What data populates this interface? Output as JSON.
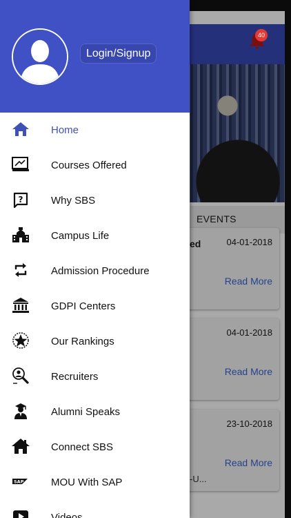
{
  "background": {
    "notification_count": "40",
    "tab_label": "EVENTS",
    "cards": [
      {
        "partial_title": "ed",
        "date": "04-01-2018",
        "read_more": "Read More",
        "snippet": ""
      },
      {
        "partial_title": "",
        "date": "04-01-2018",
        "read_more": "Read More",
        "snippet": ""
      },
      {
        "partial_title": "",
        "date": "23-10-2018",
        "read_more": "Read More",
        "snippet": "-U..."
      }
    ]
  },
  "drawer": {
    "header_color": "#3f51c4",
    "login_label": "Login/Signup",
    "active_color": "#3f51b5",
    "items": [
      {
        "label": "Home",
        "icon": "home-icon",
        "active": true
      },
      {
        "label": "Courses Offered",
        "icon": "courses-board-icon"
      },
      {
        "label": "Why SBS",
        "icon": "question-icon"
      },
      {
        "label": "Campus Life",
        "icon": "campus-building-icon"
      },
      {
        "label": "Admission Procedure",
        "icon": "refresh-arrows-icon"
      },
      {
        "label": "GDPI Centers",
        "icon": "institution-icon"
      },
      {
        "label": "Our Rankings",
        "icon": "star-badge-icon"
      },
      {
        "label": "Recruiters",
        "icon": "recruiter-search-icon"
      },
      {
        "label": "Alumni Speaks",
        "icon": "graduate-icon"
      },
      {
        "label": "Connect SBS",
        "icon": "house-icon"
      },
      {
        "label": "MOU With SAP",
        "icon": "sap-logo-icon"
      },
      {
        "label": "Videos",
        "icon": "video-play-icon"
      }
    ]
  }
}
